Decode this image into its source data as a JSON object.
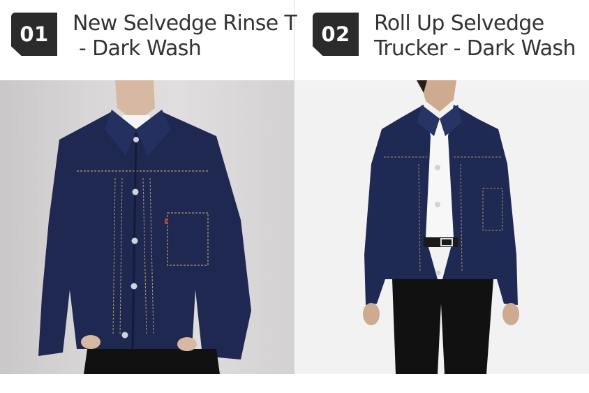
{
  "products": [
    {
      "number": "01",
      "title_line1": "New Selvedge Rinse T",
      "title_line2": " - Dark Wash",
      "image_alt": "Dark wash selvedge denim trucker jacket worn over a white tee"
    },
    {
      "number": "02",
      "title_line1": "Roll Up Selvedge",
      "title_line2": "Trucker - Dark Wash",
      "image_alt": "Dark wash roll up selvedge trucker jacket worn over a white tee with black jeans"
    }
  ],
  "colors": {
    "badge_bg": "#2b2b2b",
    "denim": "#1f2a52",
    "stitch": "#b89a6a"
  }
}
